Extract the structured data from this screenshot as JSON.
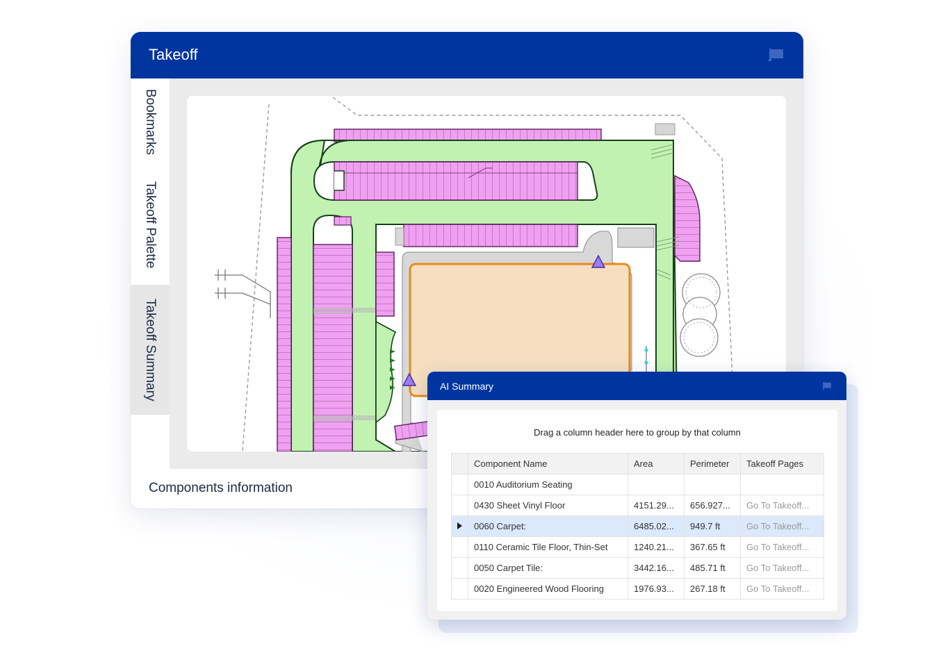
{
  "main_window": {
    "title": "Takeoff",
    "sidebar_tabs": [
      {
        "label": "Bookmarks",
        "active": false
      },
      {
        "label": "Takeoff Palette",
        "active": false
      },
      {
        "label": "Takeoff Summary",
        "active": true
      }
    ],
    "footer_label": "Components information"
  },
  "ai_summary": {
    "title": "AI Summary",
    "group_hint": "Drag a column header here to group by that column",
    "columns": [
      "Component Name",
      "Area",
      "Perimeter",
      "Takeoff Pages"
    ],
    "rows": [
      {
        "name": "0010 Auditorium Seating",
        "area": "",
        "perimeter": "",
        "pages": "",
        "selected": false
      },
      {
        "name": "0430 Sheet Vinyl Floor",
        "area": "4151.29...",
        "perimeter": "656.927...",
        "pages": "Go To Takeoff...",
        "selected": false
      },
      {
        "name": "0060 Carpet:",
        "area": "6485.02...",
        "perimeter": "949.7 ft",
        "pages": "Go To Takeoff...",
        "selected": true
      },
      {
        "name": "0110 Ceramic Tile Floor, Thin-Set",
        "area": "1240.21...",
        "perimeter": "367.65 ft",
        "pages": "Go To Takeoff...",
        "selected": false
      },
      {
        "name": "0050 Carpet Tile:",
        "area": "3442.16...",
        "perimeter": "485.71 ft",
        "pages": "Go To Takeoff...",
        "selected": false
      },
      {
        "name": "0020 Engineered Wood Flooring",
        "area": "1976.93...",
        "perimeter": "267.18 ft",
        "pages": "Go To Takeoff...",
        "selected": false
      }
    ]
  },
  "colors": {
    "header_blue": "#0035a0",
    "parking_magenta": "#f0a0f0",
    "driveway_green": "#c2f2b2",
    "building_fill": "#f5dfc0",
    "building_outline": "#e8891e",
    "marker_purple": "#9a7cf0"
  },
  "icons": {
    "pin": "pin-icon",
    "row_indicator": "triangle-right-icon"
  }
}
